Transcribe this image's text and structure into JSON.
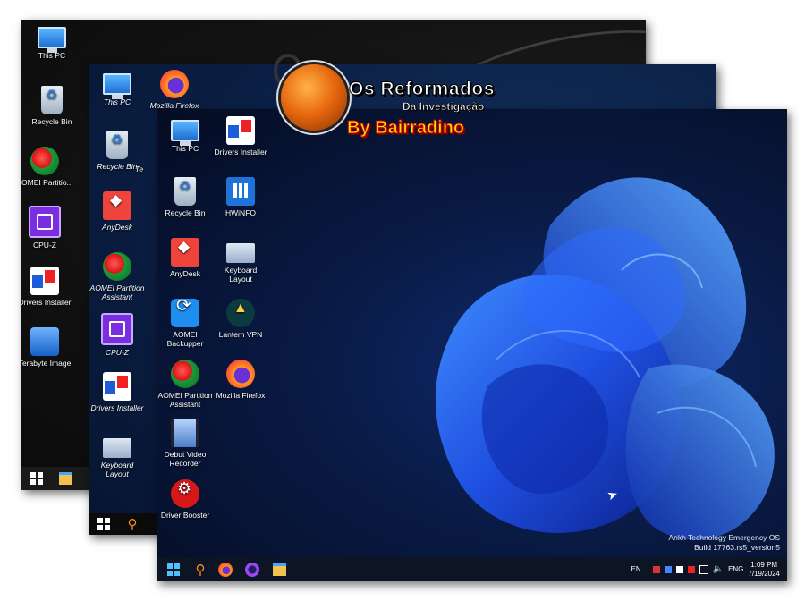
{
  "screens": {
    "back": {
      "icons": [
        {
          "label": "This PC"
        },
        {
          "label": "Recycle Bin"
        },
        {
          "label": "AOMEI Partitio..."
        },
        {
          "label": "CPU-Z"
        },
        {
          "label": "Drivers Installer"
        },
        {
          "label": "Terabyte Image"
        }
      ]
    },
    "middle": {
      "icons": [
        {
          "label": "This PC"
        },
        {
          "label": "Mozilla Firefox"
        },
        {
          "label": "Recycle Bin"
        },
        {
          "label": "Te"
        },
        {
          "label": "AnyDesk"
        },
        {
          "label": "AOMEI Partition Assistant"
        },
        {
          "label": "CPU-Z"
        },
        {
          "label": "Drivers Installer"
        },
        {
          "label": "Keyboard Layout"
        }
      ]
    },
    "front": {
      "icons": [
        {
          "label": "This PC"
        },
        {
          "label": "Drivers Installer"
        },
        {
          "label": "Recycle Bin"
        },
        {
          "label": "HWiNFO"
        },
        {
          "label": "AnyDesk"
        },
        {
          "label": "Keyboard Layout"
        },
        {
          "label": "AOMEI Backupper"
        },
        {
          "label": "Lantern VPN"
        },
        {
          "label": "AOMEI Partition Assistant"
        },
        {
          "label": "Mozilla Firefox"
        },
        {
          "label": "Debut Video Recorder"
        },
        {
          "label": "Driver Booster"
        }
      ],
      "os_info": {
        "line1": "Ankh Technology Emergency OS",
        "line2": "Build 17763.rs5_version5"
      },
      "taskbar": {
        "input_lang": "EN",
        "lang": "ENG",
        "time": "1:09 PM",
        "date": "7/19/2024"
      }
    }
  },
  "logo": {
    "line1": "Os Reformados",
    "line2": "Da Investigação",
    "line3": "By Bairradino"
  }
}
